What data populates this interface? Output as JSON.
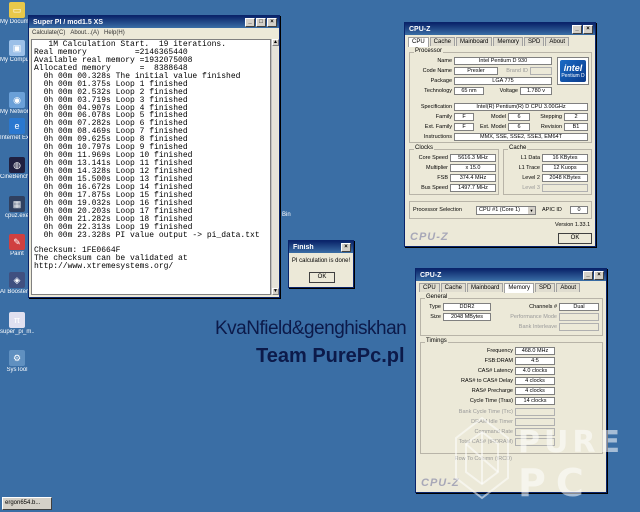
{
  "desktop": {
    "icons": [
      {
        "label": "My Documents",
        "icon": "folder-icon",
        "color": "#e8c84a"
      },
      {
        "label": "My Computer",
        "icon": "computer-icon",
        "color": "#9cc0e8"
      },
      {
        "label": "My Network Places",
        "icon": "network-icon",
        "color": "#6aa0d8"
      },
      {
        "label": "Internet Explorer",
        "icon": "ie-icon",
        "color": "#2a78d0"
      },
      {
        "label": "CineBench 64 Bit.exe",
        "icon": "cinebench-icon",
        "color": "#202040"
      },
      {
        "label": "cpuz.exe",
        "icon": "cpuz-icon",
        "color": "#304060"
      },
      {
        "label": "Paint",
        "icon": "paint-icon",
        "color": "#d04040"
      },
      {
        "label": "AI Booster v2.00.62",
        "icon": "booster-icon",
        "color": "#405080"
      },
      {
        "label": "super_pi_m...",
        "icon": "superpi-icon",
        "color": "#e0e0f0"
      },
      {
        "label": "SysTool",
        "icon": "gear-icon",
        "color": "#6090c0"
      }
    ],
    "recycle_label": "Bin",
    "taskbar_item": "ergon654.b..."
  },
  "superpi": {
    "title": "Super PI / mod1.5 XS",
    "menu": [
      "Calculate(C)",
      "About...(A)",
      "Help(H)"
    ],
    "lines": [
      "   1M Calculation Start.  19 iterations.",
      "Real memory          =2146365440",
      "Available real memory =1932075008",
      "Allocated memory      =  8388648",
      "  0h 00m 00.328s The initial value finished",
      "  0h 00m 01.375s Loop 1 finished",
      "  0h 00m 02.532s Loop 2 finished",
      "  0h 00m 03.719s Loop 3 finished",
      "  0h 00m 04.907s Loop 4 finished",
      "  0h 00m 06.078s Loop 5 finished",
      "  0h 00m 07.282s Loop 6 finished",
      "  0h 00m 08.469s Loop 7 finished",
      "  0h 00m 09.625s Loop 8 finished",
      "  0h 00m 10.797s Loop 9 finished",
      "  0h 00m 11.969s Loop 10 finished",
      "  0h 00m 13.141s Loop 11 finished",
      "  0h 00m 14.328s Loop 12 finished",
      "  0h 00m 15.500s Loop 13 finished",
      "  0h 00m 16.672s Loop 14 finished",
      "  0h 00m 17.875s Loop 15 finished",
      "  0h 00m 19.032s Loop 16 finished",
      "  0h 00m 20.203s Loop 17 finished",
      "  0h 00m 21.282s Loop 18 finished",
      "  0h 00m 22.313s Loop 19 finished",
      "  0h 00m 23.328s PI value output -> pi_data.txt",
      "",
      "Checksum: 1FE0664F",
      "The checksum can be validated at",
      "http://www.xtremesystems.org/"
    ]
  },
  "finish": {
    "title": "Finish",
    "message": "PI calculation is done!",
    "ok": "OK"
  },
  "cpuz1": {
    "title": "CPU-Z",
    "tabs": [
      "CPU",
      "Cache",
      "Mainboard",
      "Memory",
      "SPD",
      "About"
    ],
    "active_tab": "CPU",
    "processor_title": "Processor",
    "name_label": "Name",
    "name": "Intel Pentium D 930",
    "codename_label": "Code Name",
    "codename": "Presler",
    "brandid_label": "Brand ID",
    "package_label": "Package",
    "package": "LGA 775",
    "technology_label": "Technology",
    "technology": "65 nm",
    "voltage_label": "Voltage",
    "voltage": "1.780 v",
    "spec_label": "Specification",
    "spec": "Intel(R) Pentium(R) D CPU 3.00GHz",
    "family_label": "Family",
    "family": "F",
    "model_label": "Model",
    "model": "6",
    "stepping_label": "Stepping",
    "stepping": "2",
    "extfamily_label": "Ext. Family",
    "extfamily": "F",
    "extmodel_label": "Ext. Model",
    "extmodel": "6",
    "revision_label": "Revision",
    "revision": "B1",
    "instructions_label": "Instructions",
    "instructions": "MMX, SSE, SSE2, SSE3, EM64T",
    "logo_brand": "intel",
    "logo_sub": "Pentium D",
    "clocks_title": "Clocks",
    "corespeed_label": "Core Speed",
    "corespeed": "5616.3 MHz",
    "multiplier_label": "Multiplier",
    "multiplier": "x 15.0",
    "fsb_label": "FSB",
    "fsb": "374.4 MHz",
    "busspeed_label": "Bus Speed",
    "busspeed": "1497.7 MHz",
    "cache_title": "Cache",
    "l1data_label": "L1 Data",
    "l1data": "16 KBytes",
    "l1trace_label": "L1 Trace",
    "l1trace": "12 Kuops",
    "level2_label": "Level 2",
    "level2": "2048 KBytes",
    "level3_label": "Level 3",
    "procsel_label": "Processor Selection",
    "procsel": "CPU #1 (Core 1)",
    "apicid_label": "APIC ID",
    "apicid": "0",
    "version": "Version 1.33.1",
    "brand": "CPU-Z",
    "ok": "OK"
  },
  "cpuz2": {
    "title": "CPU-Z",
    "tabs": [
      "CPU",
      "Cache",
      "Mainboard",
      "Memory",
      "SPD",
      "About"
    ],
    "active_tab": "Memory",
    "general_title": "General",
    "type_label": "Type",
    "type": "DDR2",
    "channels_label": "Channels #",
    "channels": "Dual",
    "size_label": "Size",
    "size": "2048 MBytes",
    "perfmode_label": "Performance Mode",
    "bankinter_label": "Bank Interleave",
    "timings_title": "Timings",
    "frequency_label": "Frequency",
    "frequency": "468.0 MHz",
    "fsbdram_label": "FSB:DRAM",
    "fsbdram": "4:5",
    "cas_label": "CAS# Latency",
    "cas": "4.0 clocks",
    "rcd_label": "RAS# to CAS# Delay",
    "rcd": "4 clocks",
    "rp_label": "RAS# Precharge",
    "rp": "4 clocks",
    "tras_label": "Cycle Time (Tras)",
    "tras": "14 clocks",
    "bct_label": "Bank Cycle Time (Trc)",
    "dit_label": "DRAM Idle Timer",
    "cr_label": "Command Rate",
    "trdram_label": "Total CAS# (tRDRAM)",
    "rtc_label": "Row To Column (tRCD)",
    "brand": "CPU-Z"
  },
  "overlay": {
    "names": "KvaNfield&genghiskhan",
    "team": "Team PurePc.pl"
  },
  "watermark": {
    "text_top": "PURE",
    "text_bottom": "PC"
  }
}
